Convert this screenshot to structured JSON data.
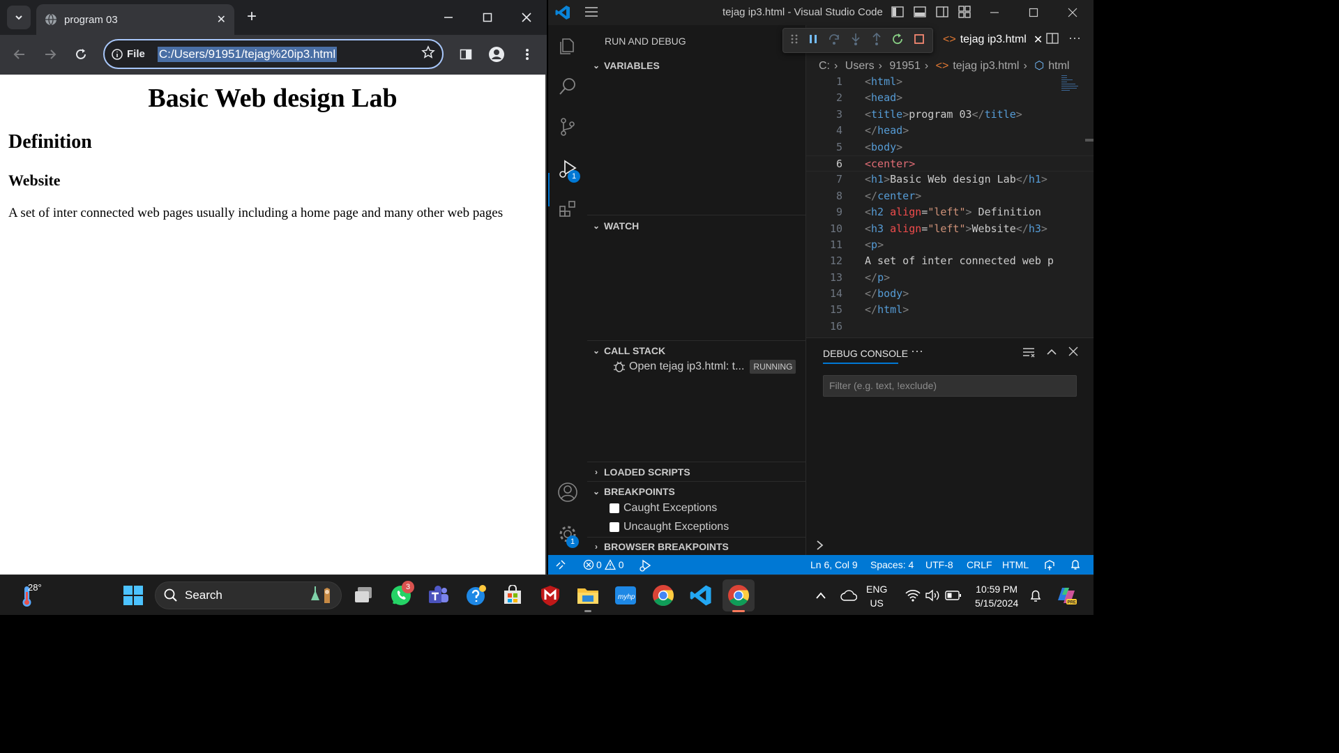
{
  "chrome": {
    "tab_title": "program 03",
    "address_scheme": "File",
    "address_url": "C:/Users/91951/tejag%20ip3.html",
    "page": {
      "h1": "Basic Web design Lab",
      "h2": "Definition",
      "h3": "Website",
      "paragraph": "A set of inter connected web pages usually including a home page and many other web pages"
    }
  },
  "vscode": {
    "window_title": "tejag ip3.html - Visual Studio Code",
    "sidebar_title": "RUN AND DEBUG",
    "sections": {
      "variables": "VARIABLES",
      "watch": "WATCH",
      "call_stack": "CALL STACK",
      "loaded_scripts": "LOADED SCRIPTS",
      "breakpoints": "BREAKPOINTS",
      "browser_breakpoints": "BROWSER BREAKPOINTS"
    },
    "call_stack_item": "Open tejag ip3.html: t...",
    "call_stack_status": "RUNNING",
    "breakpoints": [
      "Caught Exceptions",
      "Uncaught Exceptions"
    ],
    "editor_tab": "tejag ip3.html",
    "breadcrumbs": [
      "C:",
      "Users",
      "91951",
      "tejag ip3.html",
      "html"
    ],
    "panel_tab": "DEBUG CONSOLE",
    "filter_placeholder": "Filter (e.g. text, !exclude)",
    "activity_badges": {
      "run_debug": "1",
      "settings": "1"
    },
    "status": {
      "errors": "0",
      "warnings": "0",
      "position": "Ln 6, Col 9",
      "spaces": "Spaces: 4",
      "encoding": "UTF-8",
      "eol": "CRLF",
      "language": "HTML"
    },
    "line_numbers": [
      "1",
      "2",
      "3",
      "4",
      "5",
      "6",
      "7",
      "8",
      "9",
      "10",
      "11",
      "12",
      "13",
      "14",
      "15",
      "16"
    ],
    "code_text": {
      "title_text": "program 03",
      "h1_text": "Basic Web design Lab",
      "h2_text": " Definition",
      "h3_text": "Website",
      "p_text": "A set of inter connected web p"
    }
  },
  "taskbar": {
    "temperature": "28°",
    "search_label": "Search",
    "whatsapp_badge": "3",
    "lang_top": "ENG",
    "lang_bottom": "US",
    "time": "10:59 PM",
    "date": "5/15/2024"
  },
  "colors": {
    "vscode_accent": "#0078d4",
    "chrome_frame": "#202124",
    "taskbar_bg": "#1c1c1c"
  }
}
